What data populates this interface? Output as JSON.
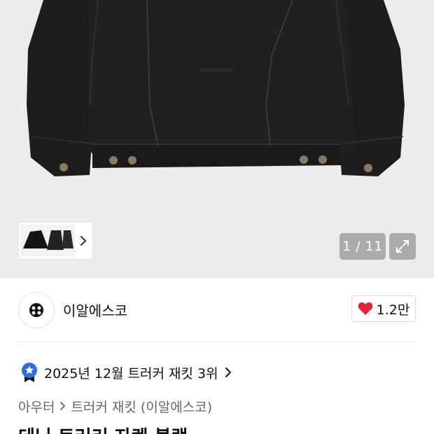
{
  "gallery": {
    "counter": "1 / 11",
    "current_index": 1,
    "total": 11
  },
  "brand": {
    "name": "이알에스코",
    "likes": "1.2만"
  },
  "ranking": {
    "text": "2025년 12월 트러커 재킷 3위"
  },
  "breadcrumb": {
    "category": "아우터",
    "subcategory": "트러커 재킷 (이알에스코)"
  },
  "product": {
    "title": "데님 트러커 자켓 블랙"
  },
  "colors": {
    "like_heart": "#e8232f",
    "rank_badge": "#2f6ddc",
    "jacket": "#1c1c1c",
    "image_bg": "#ececec"
  },
  "icons": {
    "thumb_next": "chevron-right-icon",
    "expand": "expand-icon",
    "like": "heart-icon",
    "rank": "ranking-badge-icon",
    "rank_more": "chevron-right-icon",
    "breadcrumb_sep": "chevron-right-icon"
  }
}
